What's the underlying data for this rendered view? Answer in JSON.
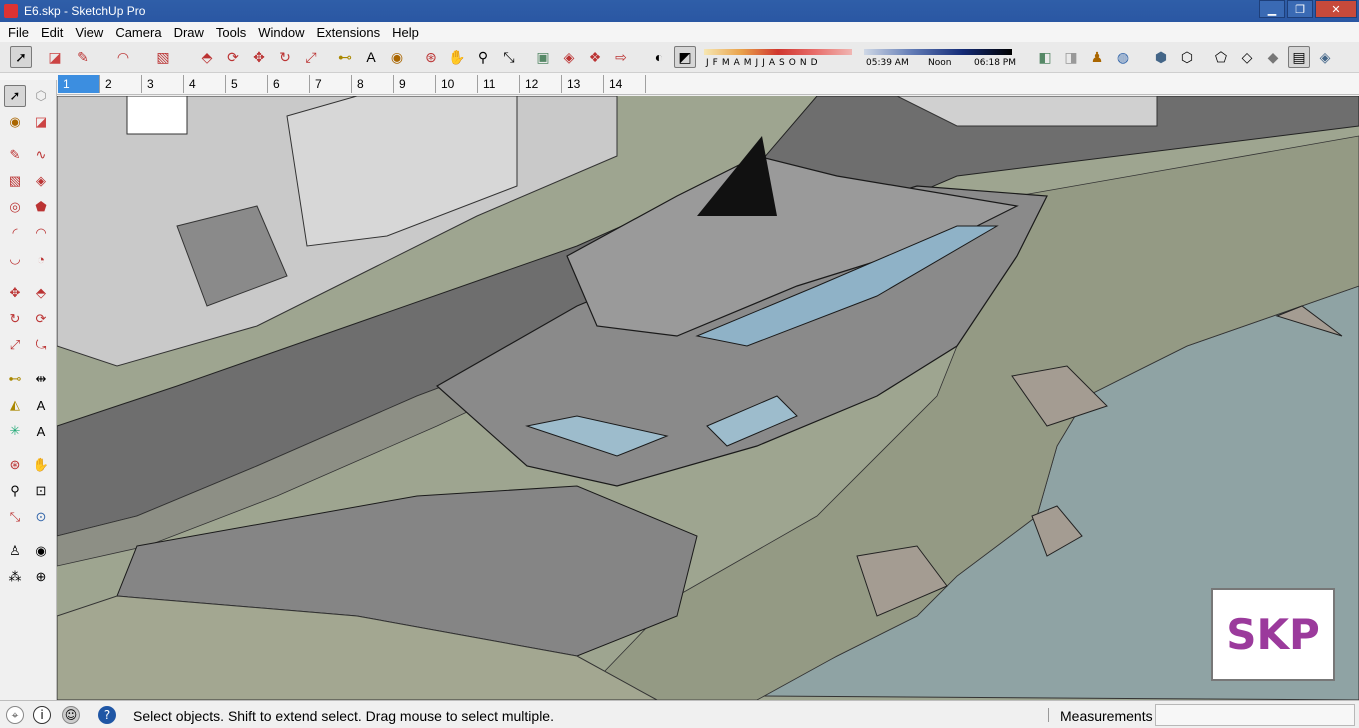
{
  "window": {
    "title": "E6.skp - SketchUp Pro",
    "minimize": "▁",
    "restore": "❐",
    "close": "✕"
  },
  "menu": [
    "File",
    "Edit",
    "View",
    "Camera",
    "Draw",
    "Tools",
    "Window",
    "Extensions",
    "Help"
  ],
  "shadows": {
    "months": [
      "J",
      "F",
      "M",
      "A",
      "M",
      "J",
      "J",
      "A",
      "S",
      "O",
      "N",
      "D"
    ],
    "time_start": "05:39 AM",
    "time_mid": "Noon",
    "time_end": "06:18 PM"
  },
  "scenes": [
    "1",
    "2",
    "3",
    "4",
    "5",
    "6",
    "7",
    "8",
    "9",
    "10",
    "11",
    "12",
    "13",
    "14"
  ],
  "active_scene": "1",
  "watermark": "SKP",
  "status": {
    "message": "Select objects. Shift to extend select. Drag mouse to select multiple.",
    "measurements_label": "Measurements",
    "measurements_value": ""
  },
  "colors": {
    "accent": "#3c8ee0",
    "title_bar": "#2f5ea8",
    "watermark": "#9b3a9c",
    "water": "#8fa3a4",
    "ground": "#9ea590"
  }
}
